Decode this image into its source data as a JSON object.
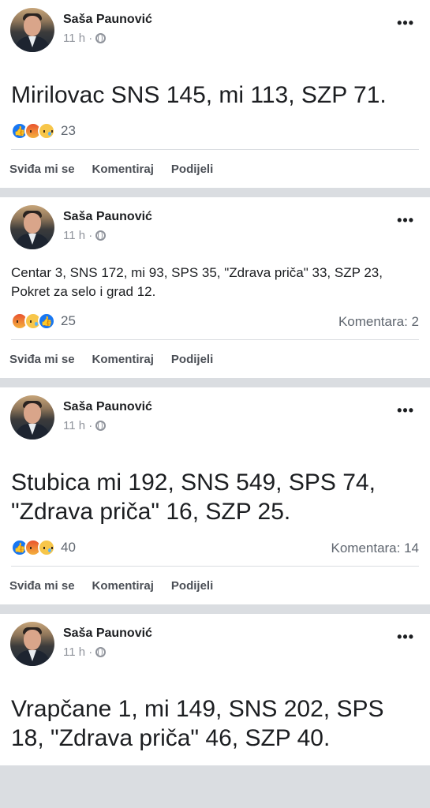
{
  "posts": [
    {
      "author": "Saša Paunović",
      "time": "11 h ·",
      "text": "Mirilovac SNS 145, mi 113, SZP 71.",
      "size": "large",
      "reactions": [
        "like",
        "angry",
        "sad"
      ],
      "reaction_count": "23",
      "comments": "",
      "actions": [
        "Sviđa mi se",
        "Komentiraj",
        "Podijeli"
      ]
    },
    {
      "author": "Saša Paunović",
      "time": "11 h ·",
      "text": "Centar 3, SNS 172, mi 93, SPS 35, \"Zdrava priča\" 33, SZP 23, Pokret za selo i grad 12.",
      "size": "small",
      "reactions": [
        "angry",
        "sad",
        "like"
      ],
      "reaction_count": "25",
      "comments": "Komentara: 2",
      "actions": [
        "Sviđa mi se",
        "Komentiraj",
        "Podijeli"
      ]
    },
    {
      "author": "Saša Paunović",
      "time": "11 h ·",
      "text": "Stubica mi 192, SNS 549, SPS 74, \"Zdrava priča\" 16, SZP 25.",
      "size": "large",
      "reactions": [
        "like",
        "angry",
        "sad"
      ],
      "reaction_count": "40",
      "comments": "Komentara: 14",
      "actions": [
        "Sviđa mi se",
        "Komentiraj",
        "Podijeli"
      ]
    },
    {
      "author": "Saša Paunović",
      "time": "11 h ·",
      "text": "Vrapčane 1, mi 149, SNS 202, SPS 18, \"Zdrava priča\" 46, SZP 40.",
      "size": "large",
      "reactions": [],
      "reaction_count": "",
      "comments": "",
      "actions": []
    }
  ],
  "icons": {
    "more": "more-options-icon",
    "privacy": "globe-icon",
    "like": "like-reaction-icon",
    "angry": "angry-reaction-icon",
    "sad": "sad-reaction-icon"
  },
  "colors": {
    "like_blue": "#1877f2",
    "secondary_text": "#606770",
    "separator": "#dadde1"
  }
}
